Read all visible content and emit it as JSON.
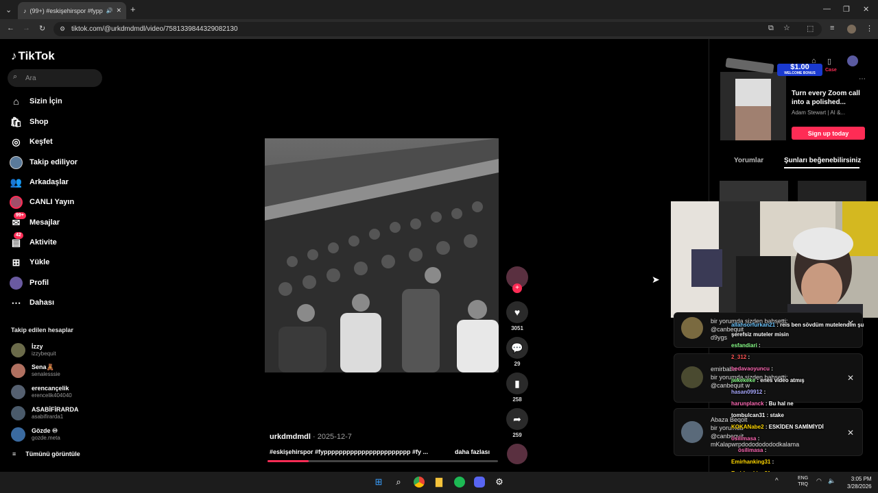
{
  "browser": {
    "tab_title": "(99+) #eskişehirspor #fypp",
    "new_tab": "+",
    "url": "tiktok.com/@urkdmdmdl/video/7581339844329082130"
  },
  "sidebar": {
    "logo": "TikTok",
    "search_placeholder": "Ara",
    "nav": [
      {
        "label": "Sizin İçin",
        "icon": "home-icon"
      },
      {
        "label": "Shop",
        "icon": "shop-icon"
      },
      {
        "label": "Keşfet",
        "icon": "compass-icon"
      },
      {
        "label": "Takip ediliyor",
        "icon": "following-avatar-icon"
      },
      {
        "label": "Arkadaşlar",
        "icon": "friends-icon"
      },
      {
        "label": "CANLI Yayın",
        "icon": "live-icon"
      },
      {
        "label": "Mesajlar",
        "icon": "messages-icon",
        "badge": "99+"
      },
      {
        "label": "Aktivite",
        "icon": "activity-icon",
        "badge": "42"
      },
      {
        "label": "Yükle",
        "icon": "upload-icon"
      },
      {
        "label": "Profil",
        "icon": "profile-icon"
      },
      {
        "label": "Dahası",
        "icon": "more-icon"
      }
    ],
    "following_title": "Takip edilen hesaplar",
    "accounts": [
      {
        "name": "İzzy",
        "handle": "izzybequit"
      },
      {
        "name": "Sena🧸",
        "handle": "senalesssie"
      },
      {
        "name": "erencançelik",
        "handle": "erencelik404040"
      },
      {
        "name": "ASABİFİRARDA",
        "handle": "asabifirarda1"
      },
      {
        "name": "Gözde ♾",
        "handle": "gozde.meta"
      }
    ],
    "see_all": "Tümünü görüntüle"
  },
  "video": {
    "username": "urkdmdmdl",
    "date": "2025-12-7",
    "description": "#eskişehirspor #fyppppppppppppppppppppppp #fy ...",
    "more": "daha fazlası",
    "progress": 0.18,
    "likes": "3051",
    "comments": "29",
    "saves": "258",
    "shares": "259"
  },
  "right_panel": {
    "ad_banner_amount": "$1.00",
    "ad_banner_sub": "WELCOME BONUS",
    "ad_brand": "Case",
    "ad_text": "Turn every Zoom call into a polished...",
    "ad_author": "Adam Stewart | AI &...",
    "ad_button": "Sign up today",
    "tab_comments": "Yorumlar",
    "tab_likes": "Şunları beğenebilirsiniz"
  },
  "notifications": [
    {
      "text1": "bir yorumda sizden bahsetti:",
      "text2": "@canbequit",
      "text3": "d9ygs"
    },
    {
      "text1": "emirbaba",
      "text2": "bir yorumda sizden bahsetti:",
      "text3": "@canbequit w"
    },
    {
      "text1": "Abaza Beqolt",
      "text2": "bir yorumda",
      "text3": "@canbequit",
      "text4": "mKalapwrpdodododododkalama"
    }
  ],
  "chat": [
    {
      "user": "allahsorfurkan21",
      "msg": ": reis ben sövdüm mutelendim şu",
      "color": "#6ec6ff"
    },
    {
      "user": "",
      "msg": "şerefsiz muteler misin",
      "color": "#fff"
    },
    {
      "user": "esfandiari",
      "msg": ":",
      "color": "#8aff8a"
    },
    {
      "user": "2_312",
      "msg": ":",
      "color": "#ff5555"
    },
    {
      "user": "bedavaoyuncu",
      "msg": ":",
      "color": "#ff69b4"
    },
    {
      "user": "jwkekeke",
      "msg": ": enes video atmış",
      "color": "#8aff8a"
    },
    {
      "user": "hasan09912",
      "msg": ":",
      "color": "#aaaaff"
    },
    {
      "user": "harunplanck",
      "msg": ": Bu hal ne",
      "color": "#ff69b4"
    },
    {
      "user": "tombulcan31",
      "msg": ": stake",
      "color": "#ffffff"
    },
    {
      "user": "KOKANabe2",
      "msg": ": ESKİDEN SAMİMİYDİ",
      "color": "#ffd700"
    },
    {
      "user": "ösilimasa",
      "msg": ":",
      "color": "#ff69b4"
    },
    {
      "user": "ösilimasa",
      "msg": ":",
      "color": "#ff69b4"
    },
    {
      "user": "Emirhanking31",
      "msg": ":",
      "color": "#ffd700"
    },
    {
      "user": "Emirhanking31",
      "msg": ":",
      "color": "#ffd700"
    },
    {
      "user": "Emirhanking31",
      "msg": ":",
      "color": "#ffd700"
    }
  ],
  "taskbar": {
    "lang1": "ENG",
    "lang2": "TRQ",
    "time": "3:05 PM",
    "date": "3/28/2026"
  },
  "colors": {
    "accent": "#fe2c55",
    "background": "#000000"
  }
}
